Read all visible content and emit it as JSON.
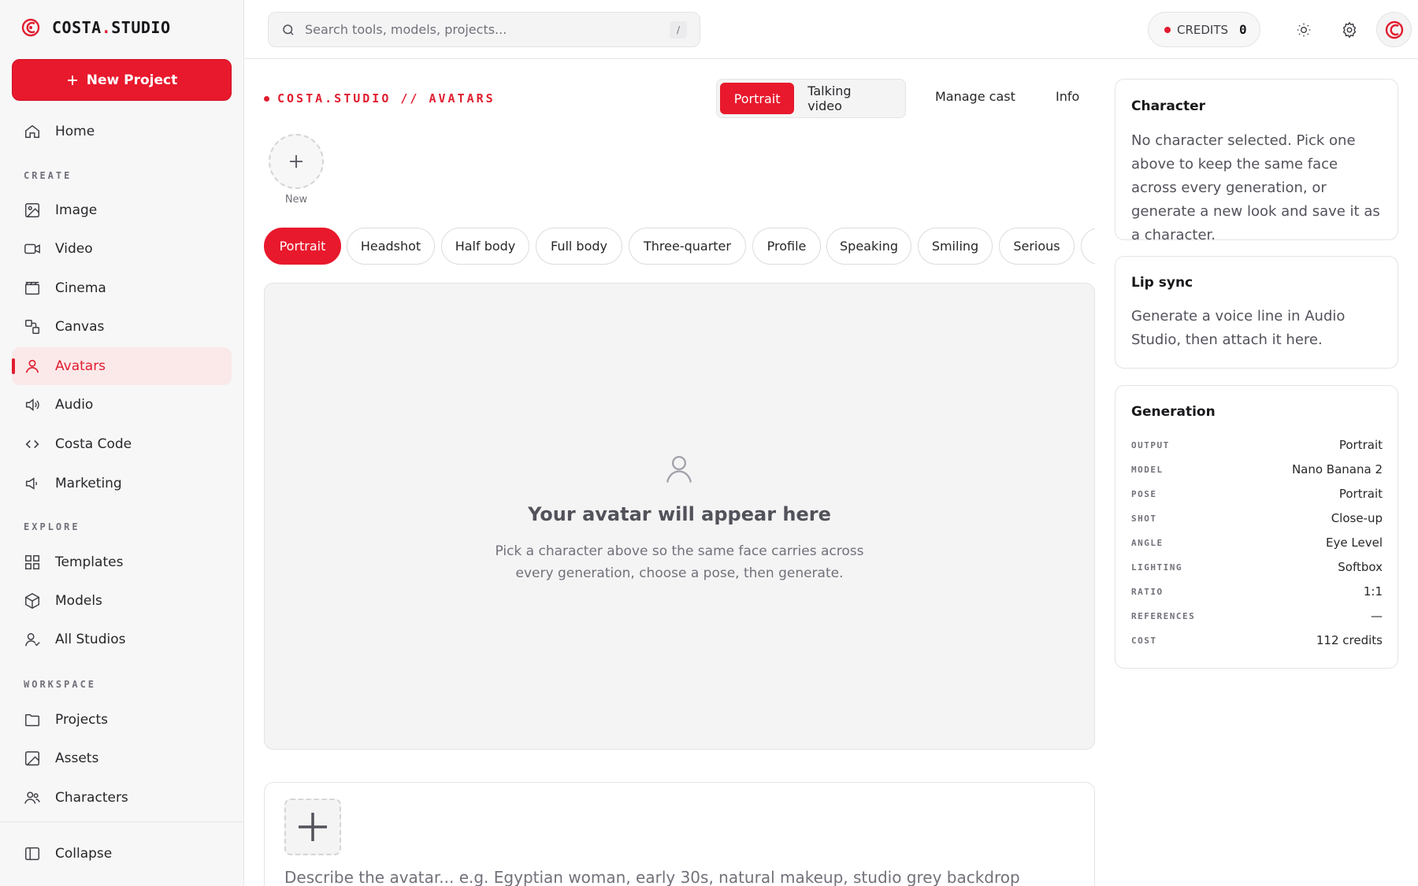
{
  "brand": {
    "name_prefix": "COSTA",
    "name_dot": ".",
    "name_suffix": "STUDIO"
  },
  "sidebar": {
    "new_project_label": "New Project",
    "home": "Home",
    "sections": {
      "create": "CREATE",
      "explore": "EXPLORE",
      "workspace": "WORKSPACE"
    },
    "create_items": [
      "Image",
      "Video",
      "Cinema",
      "Canvas",
      "Avatars",
      "Audio",
      "Costa Code",
      "Marketing"
    ],
    "explore_items": [
      "Templates",
      "Models",
      "All Studios"
    ],
    "workspace_items": [
      "Projects",
      "Assets",
      "Characters"
    ],
    "collapse_label": "Collapse",
    "active_item": "Avatars"
  },
  "topbar": {
    "search_placeholder": "Search tools, models, projects...",
    "search_shortcut": "/",
    "credits_label": "CREDITS",
    "credits_value": "0"
  },
  "main": {
    "breadcrumb": "COSTA.STUDIO // AVATARS",
    "mode_tabs": [
      "Portrait",
      "Talking video"
    ],
    "active_mode": "Portrait",
    "links": [
      "Manage cast",
      "Info"
    ],
    "new_character_label": "New",
    "pose_chips": [
      "Portrait",
      "Headshot",
      "Half body",
      "Full body",
      "Three-quarter",
      "Profile",
      "Speaking",
      "Smiling",
      "Serious"
    ],
    "active_chip": "Portrait",
    "empty_title": "Your avatar will appear here",
    "empty_text_line1": "Pick a character above so the same face carries across",
    "empty_text_line2": "every generation, choose a pose, then generate.",
    "prompt_placeholder": "Describe the avatar...  e.g. Egyptian woman, early 30s, natural makeup, studio grey backdrop"
  },
  "panel": {
    "character": {
      "title": "Character",
      "body": "No character selected. Pick one above to keep the same face across every generation, or generate a new look and save it as a character."
    },
    "lip_sync": {
      "title": "Lip sync",
      "body": "Generate a voice line in Audio Studio, then attach it here."
    },
    "generation": {
      "title": "Generation",
      "rows": [
        {
          "key": "OUTPUT",
          "value": "Portrait"
        },
        {
          "key": "MODEL",
          "value": "Nano Banana 2"
        },
        {
          "key": "POSE",
          "value": "Portrait"
        },
        {
          "key": "SHOT",
          "value": "Close-up"
        },
        {
          "key": "ANGLE",
          "value": "Eye Level"
        },
        {
          "key": "LIGHTING",
          "value": "Softbox"
        },
        {
          "key": "RATIO",
          "value": "1:1"
        },
        {
          "key": "REFERENCES",
          "value": "—"
        },
        {
          "key": "COST",
          "value": "112 credits"
        }
      ]
    }
  },
  "colors": {
    "accent": "#e8192c",
    "active_bg": "#fbe9ea",
    "sidebar_bg": "#f7f7f8"
  }
}
